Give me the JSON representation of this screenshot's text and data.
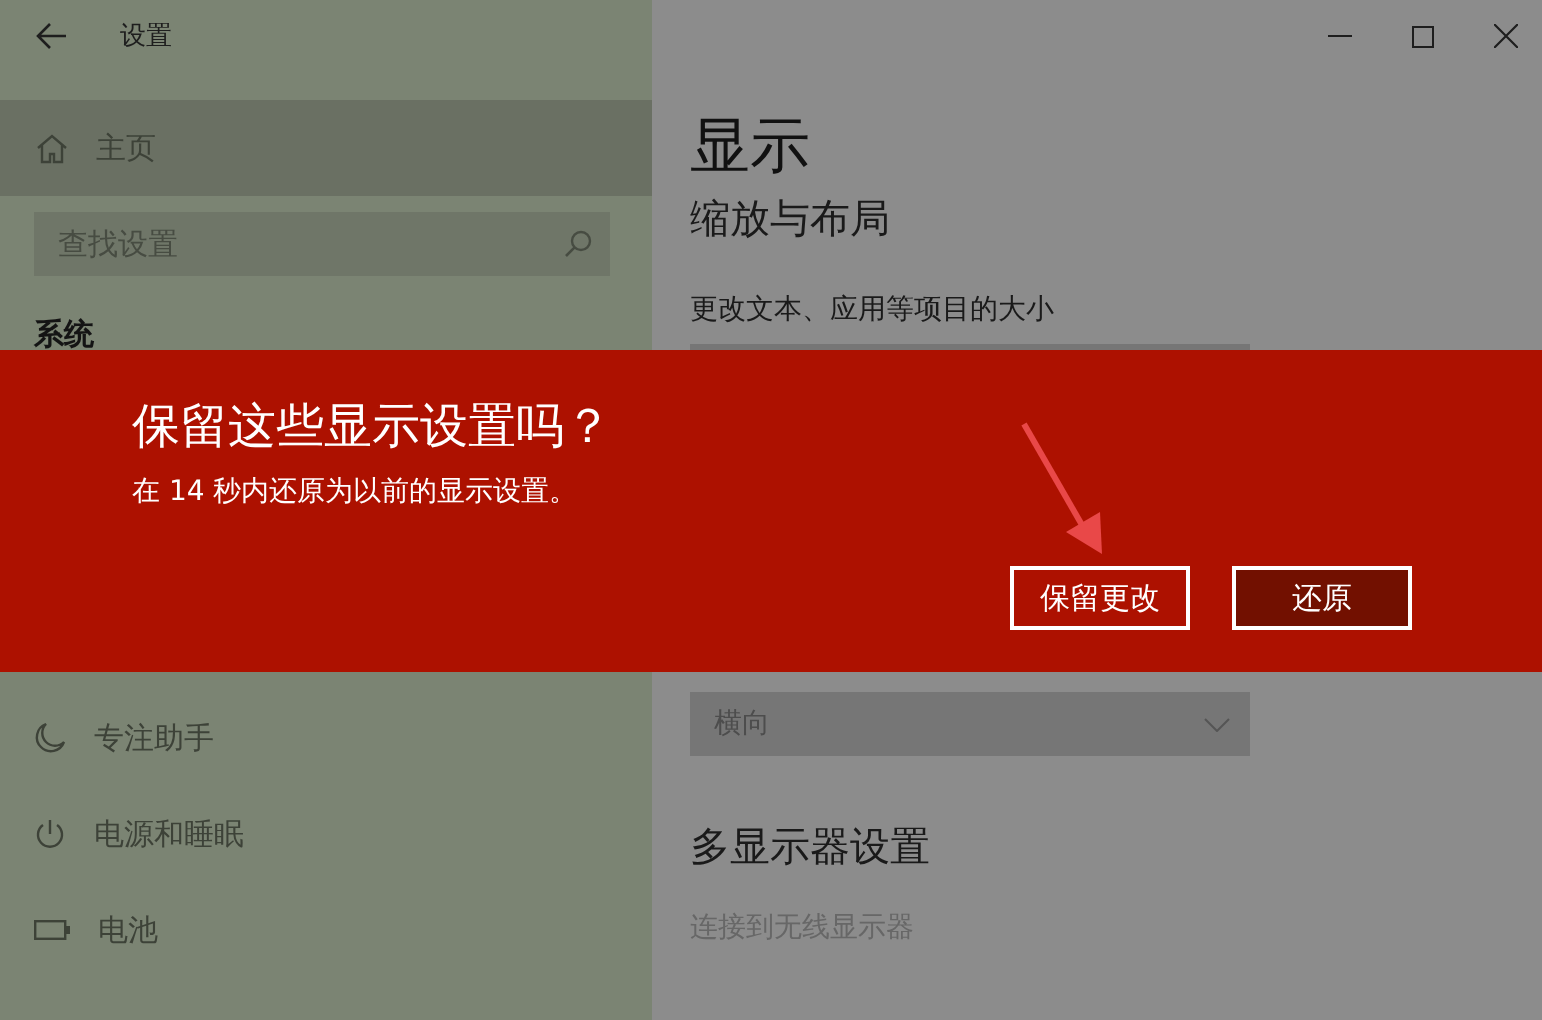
{
  "window": {
    "title": "设置"
  },
  "sidebar": {
    "home": {
      "label": "主页"
    },
    "search": {
      "placeholder": "查找设置"
    },
    "section": "系统",
    "items": [
      {
        "label": "专注助手",
        "kind": "moon"
      },
      {
        "label": "电源和睡眠",
        "kind": "power"
      },
      {
        "label": "电池",
        "kind": "battery"
      }
    ]
  },
  "page": {
    "title": "显示",
    "section": "缩放与布局",
    "scale_label": "更改文本、应用等项目的大小",
    "orientation": {
      "value": "横向"
    },
    "multi_title": "多显示器设置",
    "wireless_link": "连接到无线显示器"
  },
  "dialog": {
    "title": "保留这些显示设置吗？",
    "message": "在 14 秒内还原为以前的显示设置。",
    "buttons": [
      {
        "label": "保留更改",
        "kind": "outline"
      },
      {
        "label": "还原",
        "kind": "filled"
      }
    ]
  }
}
